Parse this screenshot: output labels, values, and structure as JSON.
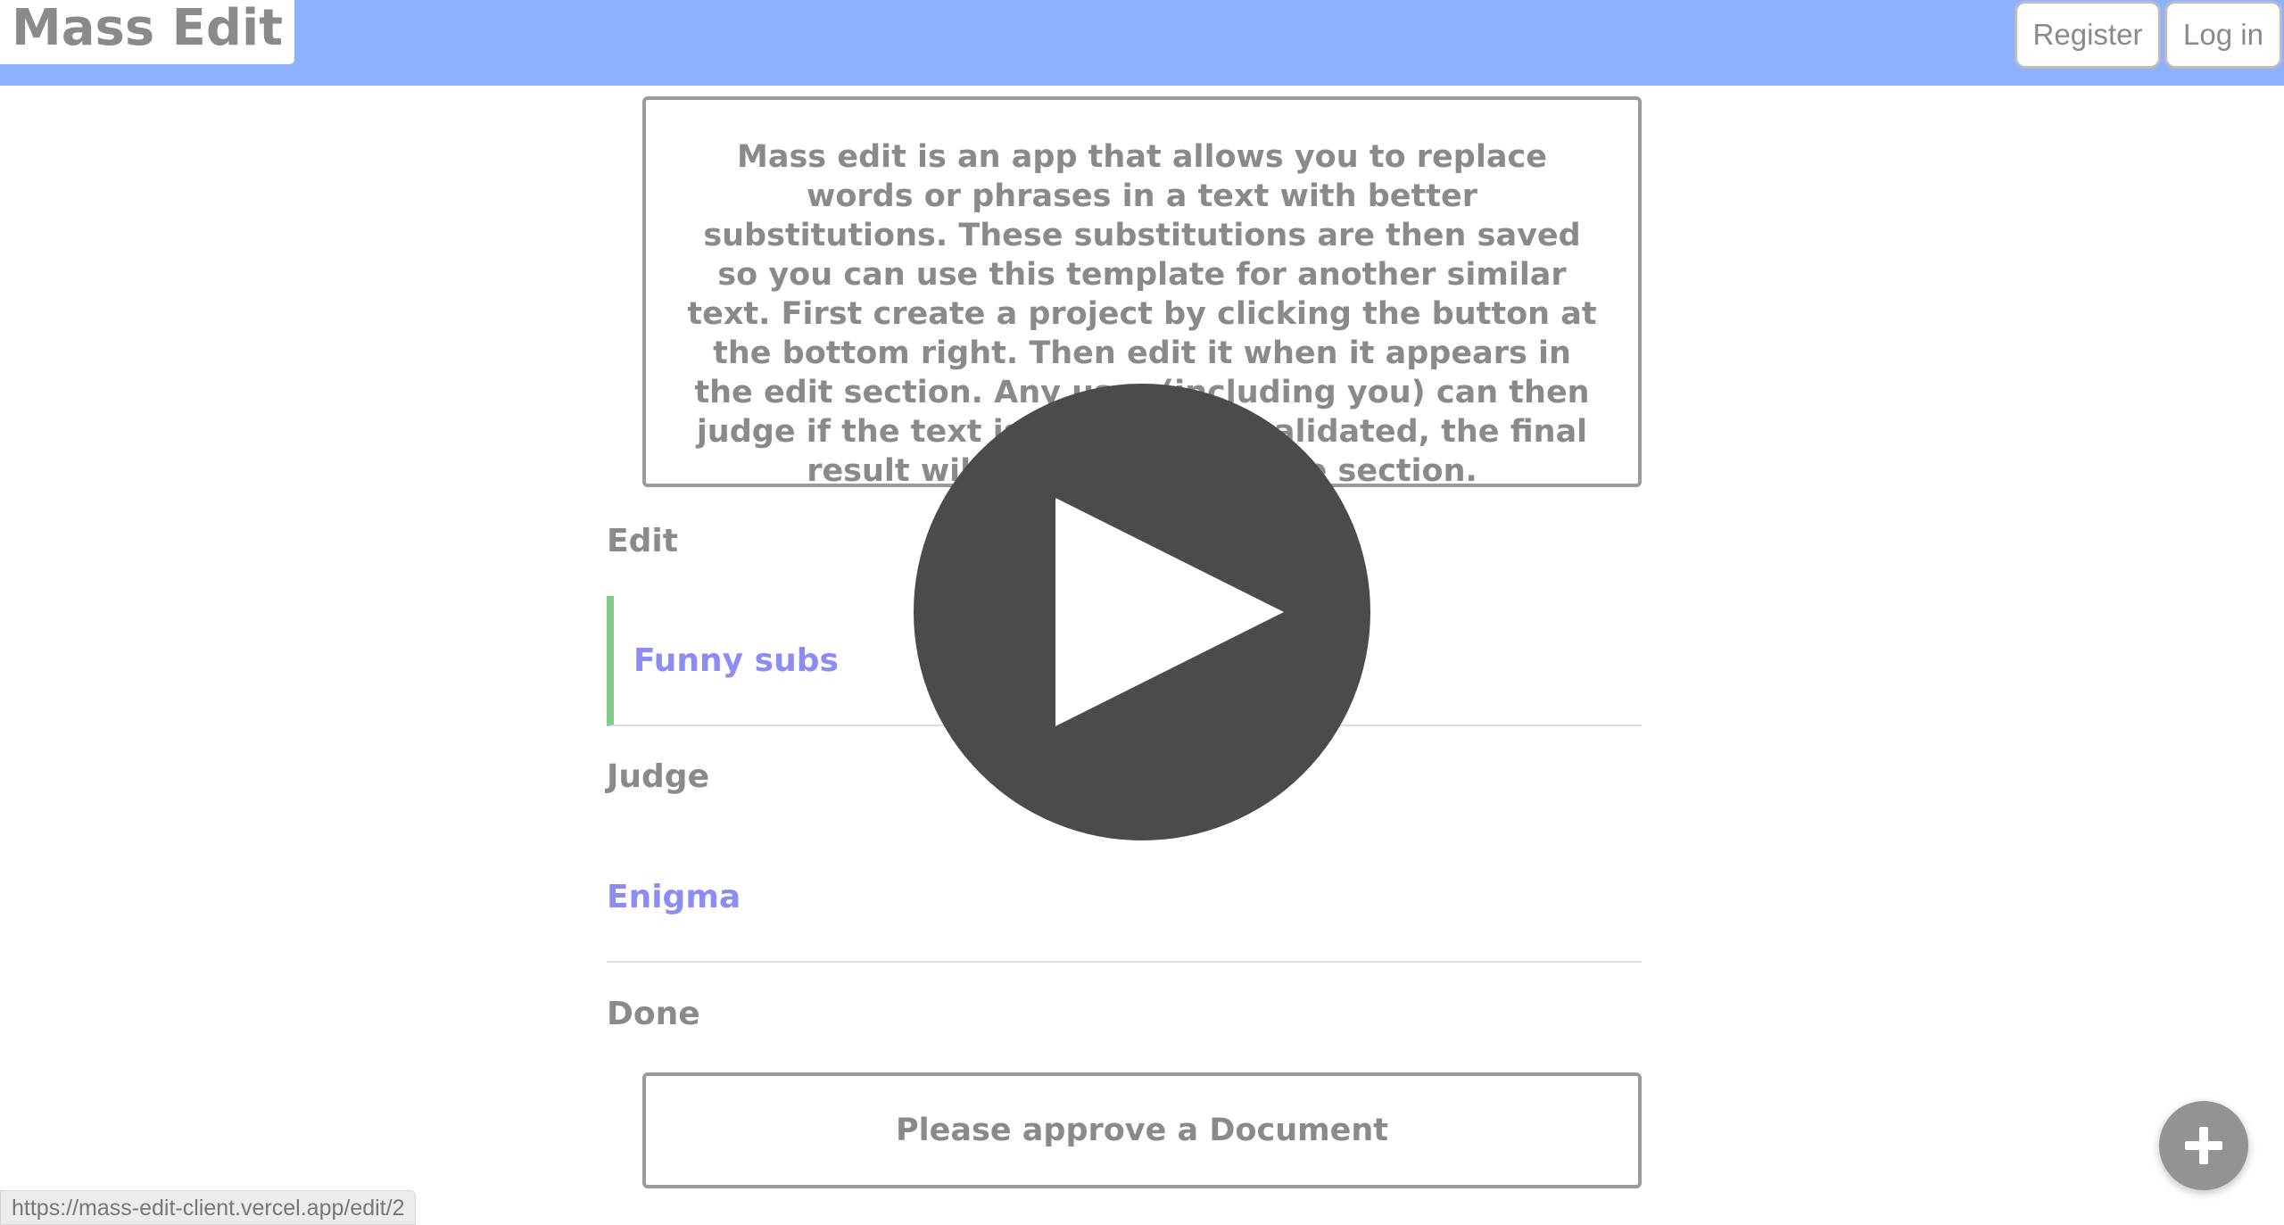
{
  "header": {
    "logo": "Mass Edit",
    "register_label": "Register",
    "login_label": "Log in",
    "bar_color": "#8eb1ff"
  },
  "intro": {
    "text": "Mass edit is an app that allows you to replace words or phrases in a text with better substitutions. These substitutions are then saved so you can use this template for another similar text. First create a project by clicking the button at the bottom right. Then edit it when it appears in the edit section. Any user (including you) can then judge if the text is valid. If it is validated, the final result will appear in the done section."
  },
  "sections": {
    "edit": {
      "title": "Edit",
      "items": [
        "Funny subs"
      ]
    },
    "judge": {
      "title": "Judge",
      "items": [
        "Enigma"
      ]
    },
    "done": {
      "title": "Done",
      "empty_message": "Please approve a Document"
    }
  },
  "overlay": {
    "icon": "play-icon"
  },
  "fab": {
    "icon": "plus-icon"
  },
  "status_bar": {
    "url": "https://mass-edit-client.vercel.app/edit/2"
  },
  "colors": {
    "link": "#8c8cf4",
    "edit_accent": "#82c98c",
    "text": "#8a8a8a"
  }
}
